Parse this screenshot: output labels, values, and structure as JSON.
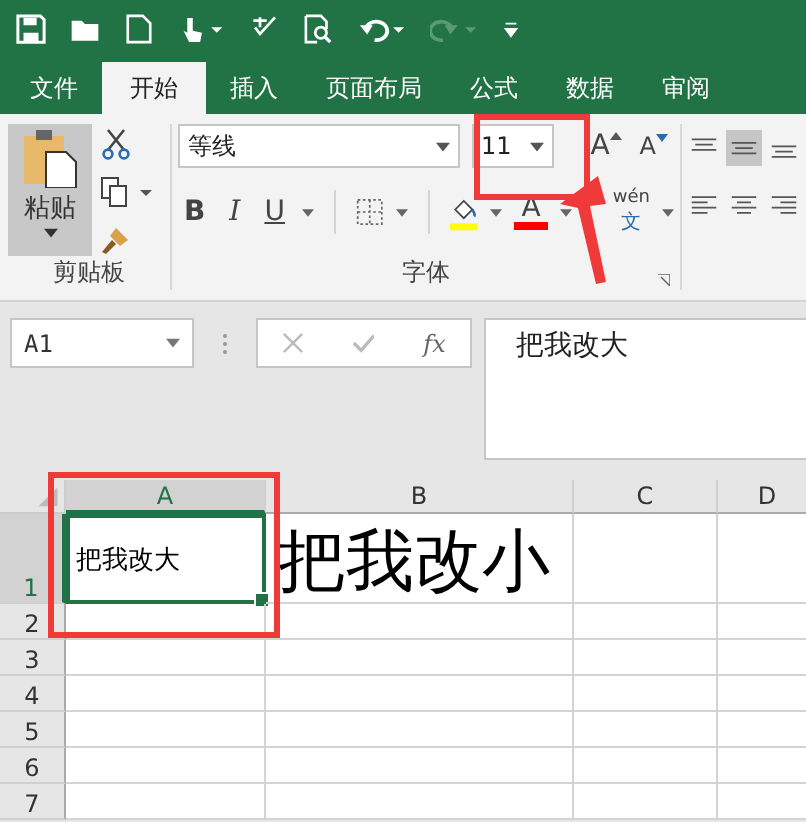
{
  "tabs": [
    {
      "label": "文件",
      "selected": false
    },
    {
      "label": "开始",
      "selected": true
    },
    {
      "label": "插入",
      "selected": false
    },
    {
      "label": "页面布局",
      "selected": false
    },
    {
      "label": "公式",
      "selected": false
    },
    {
      "label": "数据",
      "selected": false
    },
    {
      "label": "审阅",
      "selected": false
    }
  ],
  "ribbon": {
    "paste_label": "粘贴",
    "clipboard_group": "剪贴板",
    "font_name": "等线",
    "font_size": "11",
    "grow_font": "A",
    "shrink_font": "A",
    "bold": "B",
    "italic": "I",
    "underline": "U",
    "font_color": "A",
    "phonetic_top": "wén",
    "phonetic_bottom": "文",
    "font_group": "字体"
  },
  "formula_bar": {
    "name_box": "A1",
    "fx": "fx",
    "formula": "把我改大"
  },
  "sheet": {
    "columns": [
      {
        "label": "A",
        "selected": true
      },
      {
        "label": "B",
        "selected": false
      },
      {
        "label": "C",
        "selected": false
      },
      {
        "label": "D",
        "selected": false
      }
    ],
    "rows": [
      {
        "label": "1",
        "selected": true,
        "cells": [
          {
            "text": "把我改大",
            "kind": "normal",
            "selected": true
          },
          {
            "text": "把我改小",
            "kind": "large",
            "selected": false
          }
        ]
      },
      {
        "label": "2",
        "selected": false,
        "cells": []
      },
      {
        "label": "3",
        "selected": false,
        "cells": []
      },
      {
        "label": "4",
        "selected": false,
        "cells": []
      },
      {
        "label": "5",
        "selected": false,
        "cells": []
      },
      {
        "label": "6",
        "selected": false,
        "cells": []
      },
      {
        "label": "7",
        "selected": false,
        "cells": []
      }
    ]
  }
}
